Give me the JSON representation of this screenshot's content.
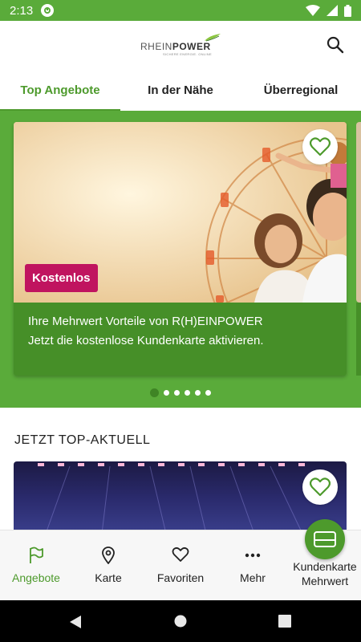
{
  "status_bar": {
    "time": "2:13"
  },
  "app_bar": {
    "logo_text_light": "RHEIN",
    "logo_text_bold": "POWER",
    "logo_subtitle": "SICHERE ENERGIE. ONLINE",
    "search_icon": "search-icon"
  },
  "tabs": [
    {
      "label": "Top Angebote",
      "active": true
    },
    {
      "label": "In der Nähe",
      "active": false
    },
    {
      "label": "Überregional",
      "active": false
    }
  ],
  "featured_card": {
    "badge": "Kostenlos",
    "line1": "Ihre Mehrwert Vorteile von R(H)EINPOWER",
    "line2": "Jetzt die kostenlose Kundenkarte aktivieren.",
    "favorite_icon": "heart-outline-icon"
  },
  "carousel": {
    "page_count": 6,
    "active_index": 0
  },
  "section": {
    "title": "JETZT TOP-AKTUELL"
  },
  "bottom_nav": [
    {
      "label": "Angebote",
      "icon": "flag-icon",
      "active": true
    },
    {
      "label": "Karte",
      "icon": "map-pin-icon",
      "active": false
    },
    {
      "label": "Favoriten",
      "icon": "heart-icon",
      "active": false
    },
    {
      "label": "Mehr",
      "icon": "more-dots-icon",
      "active": false
    }
  ],
  "kundenkarte": {
    "line1": "Kundenkarte",
    "line2": "Mehrwert",
    "icon": "card-icon"
  },
  "colors": {
    "brand_green": "#5aab3a",
    "dark_green": "#468f28",
    "badge_magenta": "#c0145f"
  }
}
